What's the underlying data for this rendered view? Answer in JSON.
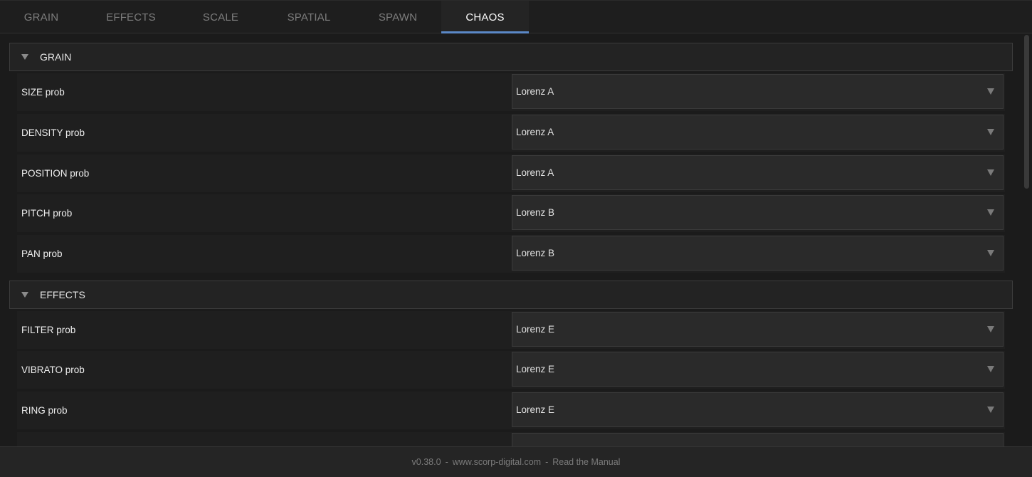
{
  "tabs": [
    {
      "label": "GRAIN"
    },
    {
      "label": "EFFECTS"
    },
    {
      "label": "SCALE"
    },
    {
      "label": "SPATIAL"
    },
    {
      "label": "SPAWN"
    },
    {
      "label": "CHAOS",
      "active": true
    }
  ],
  "sections": [
    {
      "title": "GRAIN",
      "rows": [
        {
          "label": "SIZE prob",
          "value": "Lorenz A"
        },
        {
          "label": "DENSITY prob",
          "value": "Lorenz A"
        },
        {
          "label": "POSITION prob",
          "value": "Lorenz A"
        },
        {
          "label": "PITCH prob",
          "value": "Lorenz B"
        },
        {
          "label": "PAN prob",
          "value": "Lorenz B"
        }
      ]
    },
    {
      "title": "EFFECTS",
      "rows": [
        {
          "label": "FILTER prob",
          "value": "Lorenz E"
        },
        {
          "label": "VIBRATO prob",
          "value": "Lorenz E"
        },
        {
          "label": "RING prob",
          "value": "Lorenz E"
        },
        {
          "label": "",
          "value": ""
        }
      ]
    }
  ],
  "footer": {
    "version": "v0.38.0",
    "separator": "-",
    "site": "www.scorp-digital.com",
    "manual": "Read the Manual"
  },
  "colors": {
    "accent": "#5b88c7",
    "background": "#1b1b1b",
    "panel": "#2a2a2a"
  },
  "icons": {
    "section_toggle": "triangle-down-icon",
    "dropdown": "caret-down-icon"
  }
}
